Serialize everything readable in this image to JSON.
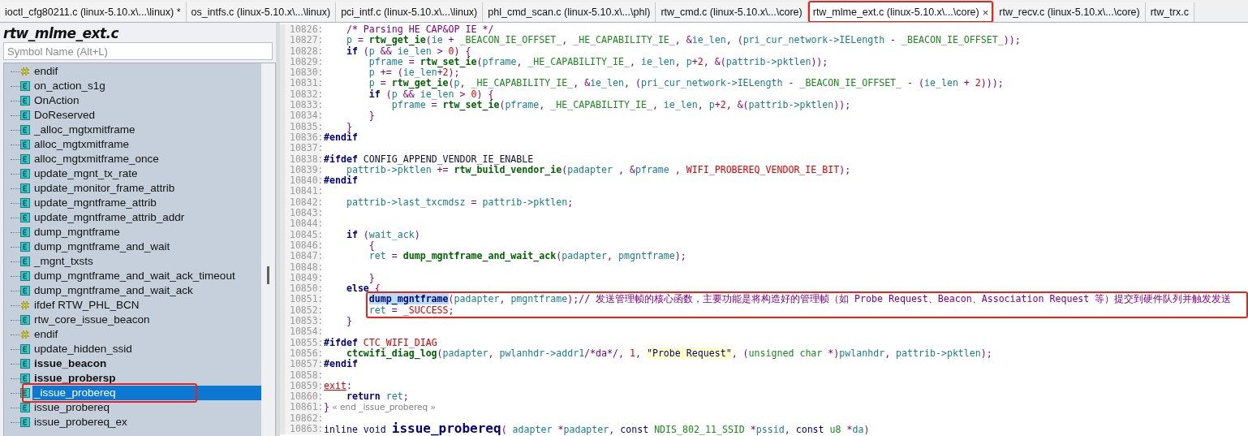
{
  "tabs": [
    {
      "label": "ioctl_cfg80211.c (linux-5.10.x\\...\\linux) *",
      "selected": false,
      "annotated": false
    },
    {
      "label": "os_intfs.c (linux-5.10.x\\...\\linux)",
      "selected": false,
      "annotated": false
    },
    {
      "label": "pci_intf.c (linux-5.10.x\\...\\linux)",
      "selected": false,
      "annotated": false
    },
    {
      "label": "phl_cmd_scan.c (linux-5.10.x\\...\\phl)",
      "selected": false,
      "annotated": false
    },
    {
      "label": "rtw_cmd.c (linux-5.10.x\\...\\core)",
      "selected": false,
      "annotated": false
    },
    {
      "label": "rtw_mlme_ext.c (linux-5.10.x\\...\\core)",
      "selected": true,
      "annotated": true,
      "close": "×"
    },
    {
      "label": "rtw_recv.c (linux-5.10.x\\...\\core)",
      "selected": false,
      "annotated": false
    },
    {
      "label": "rtw_trx.c",
      "selected": false,
      "annotated": false
    }
  ],
  "sidebar": {
    "title": "rtw_mlme_ext.c",
    "search": {
      "placeholder": "Symbol Name (Alt+L)"
    },
    "items": [
      {
        "label": "endif",
        "kind": "macro",
        "bold": false,
        "selected": false,
        "annotated": false
      },
      {
        "label": "on_action_s1g",
        "kind": "function",
        "bold": false,
        "selected": false,
        "annotated": false
      },
      {
        "label": "OnAction",
        "kind": "function",
        "bold": false,
        "selected": false,
        "annotated": false
      },
      {
        "label": "DoReserved",
        "kind": "function",
        "bold": false,
        "selected": false,
        "annotated": false
      },
      {
        "label": "_alloc_mgtxmitframe",
        "kind": "function",
        "bold": false,
        "selected": false,
        "annotated": false
      },
      {
        "label": "alloc_mgtxmitframe",
        "kind": "function",
        "bold": false,
        "selected": false,
        "annotated": false
      },
      {
        "label": "alloc_mgtxmitframe_once",
        "kind": "function",
        "bold": false,
        "selected": false,
        "annotated": false
      },
      {
        "label": "update_mgnt_tx_rate",
        "kind": "function",
        "bold": false,
        "selected": false,
        "annotated": false
      },
      {
        "label": "update_monitor_frame_attrib",
        "kind": "function",
        "bold": false,
        "selected": false,
        "annotated": false
      },
      {
        "label": "update_mgntframe_attrib",
        "kind": "function",
        "bold": false,
        "selected": false,
        "annotated": false
      },
      {
        "label": "update_mgntframe_attrib_addr",
        "kind": "function",
        "bold": false,
        "selected": false,
        "annotated": false
      },
      {
        "label": "dump_mgntframe",
        "kind": "function",
        "bold": false,
        "selected": false,
        "annotated": false
      },
      {
        "label": "dump_mgntframe_and_wait",
        "kind": "function",
        "bold": false,
        "selected": false,
        "annotated": false
      },
      {
        "label": "_mgnt_txsts",
        "kind": "function",
        "bold": false,
        "selected": false,
        "annotated": false
      },
      {
        "label": "dump_mgntframe_and_wait_ack_timeout",
        "kind": "function",
        "bold": false,
        "selected": false,
        "annotated": false
      },
      {
        "label": "dump_mgntframe_and_wait_ack",
        "kind": "function",
        "bold": false,
        "selected": false,
        "annotated": false
      },
      {
        "label": "ifdef RTW_PHL_BCN",
        "kind": "macro",
        "bold": false,
        "selected": false,
        "annotated": false
      },
      {
        "label": "rtw_core_issue_beacon",
        "kind": "function",
        "bold": false,
        "selected": false,
        "annotated": false
      },
      {
        "label": "endif",
        "kind": "macro",
        "bold": false,
        "selected": false,
        "annotated": false
      },
      {
        "label": "update_hidden_ssid",
        "kind": "function",
        "bold": false,
        "selected": false,
        "annotated": false
      },
      {
        "label": "issue_beacon",
        "kind": "function",
        "bold": true,
        "selected": false,
        "annotated": false
      },
      {
        "label": "issue_probersp",
        "kind": "function",
        "bold": true,
        "selected": false,
        "annotated": false
      },
      {
        "label": "_issue_probereq",
        "kind": "function",
        "bold": false,
        "selected": true,
        "annotated": true
      },
      {
        "label": "issue_probereq",
        "kind": "function",
        "bold": false,
        "selected": false,
        "annotated": false
      },
      {
        "label": "issue_probereq_ex",
        "kind": "function",
        "bold": false,
        "selected": false,
        "annotated": false
      }
    ]
  },
  "code": {
    "lines": [
      {
        "number": "10826:",
        "annotated": false,
        "tokens": [
          {
            "text": "    /* Parsing HE CAP&OP IE */",
            "kind": "comment"
          }
        ]
      },
      {
        "number": "10827:",
        "annotated": false,
        "tokens": [
          {
            "text": "    p",
            "kind": "var"
          },
          {
            "text": " = ",
            "kind": "punct"
          },
          {
            "text": "rtw_get_ie",
            "kind": "func"
          },
          {
            "text": "(",
            "kind": "punct"
          },
          {
            "text": "ie",
            "kind": "var"
          },
          {
            "text": " + ",
            "kind": "punct"
          },
          {
            "text": "_BEACON_IE_OFFSET_",
            "kind": "const"
          },
          {
            "text": ", ",
            "kind": "punct"
          },
          {
            "text": "_HE_CAPABILITY_IE_",
            "kind": "const"
          },
          {
            "text": ", &",
            "kind": "punct"
          },
          {
            "text": "ie_len",
            "kind": "var"
          },
          {
            "text": ", (",
            "kind": "punct"
          },
          {
            "text": "pri_cur_network->IELength",
            "kind": "var"
          },
          {
            "text": " - ",
            "kind": "punct"
          },
          {
            "text": "_BEACON_IE_OFFSET_",
            "kind": "const"
          },
          {
            "text": "));",
            "kind": "punct"
          }
        ]
      },
      {
        "number": "10828:",
        "annotated": false,
        "tokens": [
          {
            "text": "    if",
            "kind": "keyword"
          },
          {
            "text": " (",
            "kind": "punct"
          },
          {
            "text": "p",
            "kind": "var"
          },
          {
            "text": " && ",
            "kind": "punct"
          },
          {
            "text": "ie_len",
            "kind": "var"
          },
          {
            "text": " > ",
            "kind": "punct"
          },
          {
            "text": "0",
            "kind": "number"
          },
          {
            "text": ") {",
            "kind": "punct"
          }
        ]
      },
      {
        "number": "10829:",
        "annotated": false,
        "tokens": [
          {
            "text": "        pframe",
            "kind": "var"
          },
          {
            "text": " = ",
            "kind": "punct"
          },
          {
            "text": "rtw_set_ie",
            "kind": "func"
          },
          {
            "text": "(",
            "kind": "punct"
          },
          {
            "text": "pframe",
            "kind": "var"
          },
          {
            "text": ", ",
            "kind": "punct"
          },
          {
            "text": "_HE_CAPABILITY_IE_",
            "kind": "const"
          },
          {
            "text": ", ",
            "kind": "punct"
          },
          {
            "text": "ie_len",
            "kind": "var"
          },
          {
            "text": ", ",
            "kind": "punct"
          },
          {
            "text": "p",
            "kind": "var"
          },
          {
            "text": "+",
            "kind": "punct"
          },
          {
            "text": "2",
            "kind": "number"
          },
          {
            "text": ", &(",
            "kind": "punct"
          },
          {
            "text": "pattrib->pktlen",
            "kind": "var"
          },
          {
            "text": "));",
            "kind": "punct"
          }
        ]
      },
      {
        "number": "10830:",
        "annotated": false,
        "tokens": [
          {
            "text": "        p",
            "kind": "var"
          },
          {
            "text": " += (",
            "kind": "punct"
          },
          {
            "text": "ie_len",
            "kind": "var"
          },
          {
            "text": "+",
            "kind": "punct"
          },
          {
            "text": "2",
            "kind": "number"
          },
          {
            "text": ");",
            "kind": "punct"
          }
        ]
      },
      {
        "number": "10831:",
        "annotated": false,
        "tokens": [
          {
            "text": "        p",
            "kind": "var"
          },
          {
            "text": " = ",
            "kind": "punct"
          },
          {
            "text": "rtw_get_ie",
            "kind": "func"
          },
          {
            "text": "(",
            "kind": "punct"
          },
          {
            "text": "p",
            "kind": "var"
          },
          {
            "text": ", ",
            "kind": "punct"
          },
          {
            "text": "_HE_CAPABILITY_IE_",
            "kind": "const"
          },
          {
            "text": ", &",
            "kind": "punct"
          },
          {
            "text": "ie_len",
            "kind": "var"
          },
          {
            "text": ", (",
            "kind": "punct"
          },
          {
            "text": "pri_cur_network->IELength",
            "kind": "var"
          },
          {
            "text": " - ",
            "kind": "punct"
          },
          {
            "text": "_BEACON_IE_OFFSET_",
            "kind": "const"
          },
          {
            "text": " - (",
            "kind": "punct"
          },
          {
            "text": "ie_len",
            "kind": "var"
          },
          {
            "text": " + ",
            "kind": "punct"
          },
          {
            "text": "2",
            "kind": "number"
          },
          {
            "text": ")));",
            "kind": "punct"
          }
        ]
      },
      {
        "number": "10832:",
        "annotated": false,
        "tokens": [
          {
            "text": "        if",
            "kind": "keyword"
          },
          {
            "text": " (",
            "kind": "punct"
          },
          {
            "text": "p",
            "kind": "var"
          },
          {
            "text": " && ",
            "kind": "punct"
          },
          {
            "text": "ie_len",
            "kind": "var"
          },
          {
            "text": " > ",
            "kind": "punct"
          },
          {
            "text": "0",
            "kind": "number"
          },
          {
            "text": ") {",
            "kind": "punct"
          }
        ]
      },
      {
        "number": "10833:",
        "annotated": false,
        "tokens": [
          {
            "text": "            pframe",
            "kind": "var"
          },
          {
            "text": " = ",
            "kind": "punct"
          },
          {
            "text": "rtw_set_ie",
            "kind": "func"
          },
          {
            "text": "(",
            "kind": "punct"
          },
          {
            "text": "pframe",
            "kind": "var"
          },
          {
            "text": ", ",
            "kind": "punct"
          },
          {
            "text": "_HE_CAPABILITY_IE_",
            "kind": "const"
          },
          {
            "text": ", ",
            "kind": "punct"
          },
          {
            "text": "ie_len",
            "kind": "var"
          },
          {
            "text": ", ",
            "kind": "punct"
          },
          {
            "text": "p",
            "kind": "var"
          },
          {
            "text": "+",
            "kind": "punct"
          },
          {
            "text": "2",
            "kind": "number"
          },
          {
            "text": ", &(",
            "kind": "punct"
          },
          {
            "text": "pattrib->pktlen",
            "kind": "var"
          },
          {
            "text": "));",
            "kind": "punct"
          }
        ]
      },
      {
        "number": "10834:",
        "annotated": false,
        "tokens": [
          {
            "text": "        }",
            "kind": "punct"
          }
        ]
      },
      {
        "number": "10835:",
        "annotated": false,
        "tokens": [
          {
            "text": "    }",
            "kind": "punct"
          }
        ]
      },
      {
        "number": "10836:",
        "annotated": false,
        "tokens": [
          {
            "text": "#endif",
            "kind": "keyword"
          }
        ]
      },
      {
        "number": "10837:",
        "annotated": false
      },
      {
        "number": "10838:",
        "annotated": false,
        "tokens": [
          {
            "text": "#ifdef",
            "kind": "keyword"
          },
          {
            "text": " CONFIG_APPEND_VENDOR_IE_ENABLE",
            "kind": "plain"
          }
        ]
      },
      {
        "number": "10839:",
        "annotated": false,
        "tokens": [
          {
            "text": "    pattrib->pktlen",
            "kind": "var"
          },
          {
            "text": " += ",
            "kind": "punct"
          },
          {
            "text": "rtw_build_vendor_ie",
            "kind": "func"
          },
          {
            "text": "(",
            "kind": "punct"
          },
          {
            "text": "padapter",
            "kind": "var"
          },
          {
            "text": " , &",
            "kind": "punct"
          },
          {
            "text": "pframe",
            "kind": "var"
          },
          {
            "text": " , ",
            "kind": "punct"
          },
          {
            "text": "WIFI_PROBEREQ_VENDOR_IE_BIT",
            "kind": "macro"
          },
          {
            "text": ");",
            "kind": "punct"
          }
        ]
      },
      {
        "number": "10840:",
        "annotated": false,
        "tokens": [
          {
            "text": "#endif",
            "kind": "keyword"
          }
        ]
      },
      {
        "number": "10841:",
        "annotated": false
      },
      {
        "number": "10842:",
        "annotated": false,
        "tokens": [
          {
            "text": "    pattrib->last_txcmdsz",
            "kind": "var"
          },
          {
            "text": " = ",
            "kind": "punct"
          },
          {
            "text": "pattrib->pktlen",
            "kind": "var"
          },
          {
            "text": ";",
            "kind": "punct"
          }
        ]
      },
      {
        "number": "10843:",
        "annotated": false
      },
      {
        "number": "10844:",
        "annotated": false
      },
      {
        "number": "10845:",
        "annotated": false,
        "tokens": [
          {
            "text": "    if",
            "kind": "keyword"
          },
          {
            "text": " (",
            "kind": "punct"
          },
          {
            "text": "wait_ack",
            "kind": "var"
          },
          {
            "text": ")",
            "kind": "punct"
          }
        ]
      },
      {
        "number": "10846:",
        "annotated": false,
        "tokens": [
          {
            "text": "        {",
            "kind": "punct"
          }
        ]
      },
      {
        "number": "10847:",
        "annotated": false,
        "tokens": [
          {
            "text": "        ret",
            "kind": "var"
          },
          {
            "text": " = ",
            "kind": "punct"
          },
          {
            "text": "dump_mgntframe_and_wait_ack",
            "kind": "func"
          },
          {
            "text": "(",
            "kind": "punct"
          },
          {
            "text": "padapter",
            "kind": "var"
          },
          {
            "text": ", ",
            "kind": "punct"
          },
          {
            "text": "pmgntframe",
            "kind": "var"
          },
          {
            "text": ");",
            "kind": "punct"
          }
        ]
      },
      {
        "number": "10848:",
        "annotated": false
      },
      {
        "number": "10849:",
        "annotated": false,
        "tokens": [
          {
            "text": "        }",
            "kind": "punct"
          }
        ]
      },
      {
        "number": "10850:",
        "annotated": false,
        "tokens": [
          {
            "text": "    else",
            "kind": "keyword"
          },
          {
            "text": " {",
            "kind": "punct"
          }
        ]
      },
      {
        "number": "10851:",
        "annotated": true,
        "tokens": [
          {
            "text": "        dump_mgntframe",
            "kind": "highlight"
          },
          {
            "text": "(",
            "kind": "punct"
          },
          {
            "text": "padapter",
            "kind": "var"
          },
          {
            "text": ", ",
            "kind": "punct"
          },
          {
            "text": "pmgntframe",
            "kind": "var"
          },
          {
            "text": ");",
            "kind": "punct"
          },
          {
            "text": "// 发送管理帧的核心函数，主要功能是将构造好的管理帧（如 Probe Request、Beacon、Association Request 等）提交到硬件队列并触发发送",
            "kind": "comment"
          }
        ]
      },
      {
        "number": "10852:",
        "annotated": true,
        "tokens": [
          {
            "text": "        ret",
            "kind": "var"
          },
          {
            "text": " = ",
            "kind": "punct"
          },
          {
            "text": "_SUCCESS",
            "kind": "macro"
          },
          {
            "text": ";",
            "kind": "punct"
          }
        ]
      },
      {
        "number": "10853:",
        "annotated": false,
        "tokens": [
          {
            "text": "    }",
            "kind": "punct"
          }
        ]
      },
      {
        "number": "10854:",
        "annotated": false
      },
      {
        "number": "10855:",
        "annotated": false,
        "tokens": [
          {
            "text": "#ifdef",
            "kind": "keyword"
          },
          {
            "text": " CTC_WIFI_DIAG",
            "kind": "macro"
          }
        ]
      },
      {
        "number": "10856:",
        "annotated": false,
        "tokens": [
          {
            "text": "    ctcwifi_diag_log",
            "kind": "func"
          },
          {
            "text": "(",
            "kind": "punct"
          },
          {
            "text": "padapter",
            "kind": "var"
          },
          {
            "text": ", ",
            "kind": "punct"
          },
          {
            "text": "pwlanhdr->addr1",
            "kind": "var"
          },
          {
            "text": "/*da*/",
            "kind": "comment"
          },
          {
            "text": ", ",
            "kind": "punct"
          },
          {
            "text": "1",
            "kind": "number"
          },
          {
            "text": ", ",
            "kind": "punct"
          },
          {
            "text": "\"Probe Request\"",
            "kind": "string"
          },
          {
            "text": ", (",
            "kind": "punct"
          },
          {
            "text": "unsigned char",
            "kind": "const"
          },
          {
            "text": " *)",
            "kind": "punct"
          },
          {
            "text": "pwlanhdr",
            "kind": "var"
          },
          {
            "text": ", ",
            "kind": "punct"
          },
          {
            "text": "pattrib->pktlen",
            "kind": "var"
          },
          {
            "text": ");",
            "kind": "punct"
          }
        ]
      },
      {
        "number": "10857:",
        "annotated": false,
        "tokens": [
          {
            "text": "#endif",
            "kind": "keyword"
          }
        ]
      },
      {
        "number": "10858:",
        "annotated": false
      },
      {
        "number": "10859:",
        "annotated": false,
        "tokens": [
          {
            "text": "exit",
            "kind": "label"
          },
          {
            "text": ":",
            "kind": "punct"
          }
        ]
      },
      {
        "number": "10860:",
        "annotated": false,
        "tokens": [
          {
            "text": "    return",
            "kind": "keyword"
          },
          {
            "text": " ret",
            "kind": "var"
          },
          {
            "text": ";",
            "kind": "punct"
          }
        ]
      },
      {
        "number": "10861:",
        "annotated": false,
        "tokens": [
          {
            "text": "}",
            "kind": "punct"
          },
          {
            "text": " « end _issue_probereq »",
            "kind": "endnote"
          }
        ]
      },
      {
        "number": "10862:",
        "annotated": false
      },
      {
        "number": "10863:",
        "annotated": false,
        "tokens": [
          {
            "text": "inline void ",
            "kind": "type"
          },
          {
            "text": "issue_probereq",
            "kind": "decl"
          },
          {
            "text": "( ",
            "kind": "punct"
          },
          {
            "text": "adapter",
            "kind": "var"
          },
          {
            "text": " *",
            "kind": "punct"
          },
          {
            "text": "padapter",
            "kind": "var"
          },
          {
            "text": ", ",
            "kind": "punct"
          },
          {
            "text": "const ",
            "kind": "type"
          },
          {
            "text": "NDIS_802_11_SSID",
            "kind": "const"
          },
          {
            "text": " *",
            "kind": "punct"
          },
          {
            "text": "pssid",
            "kind": "var"
          },
          {
            "text": ", ",
            "kind": "punct"
          },
          {
            "text": "const ",
            "kind": "type"
          },
          {
            "text": "u8",
            "kind": "const"
          },
          {
            "text": " *",
            "kind": "punct"
          },
          {
            "text": "da",
            "kind": "var"
          },
          {
            "text": ")",
            "kind": "punct"
          }
        ]
      }
    ]
  }
}
